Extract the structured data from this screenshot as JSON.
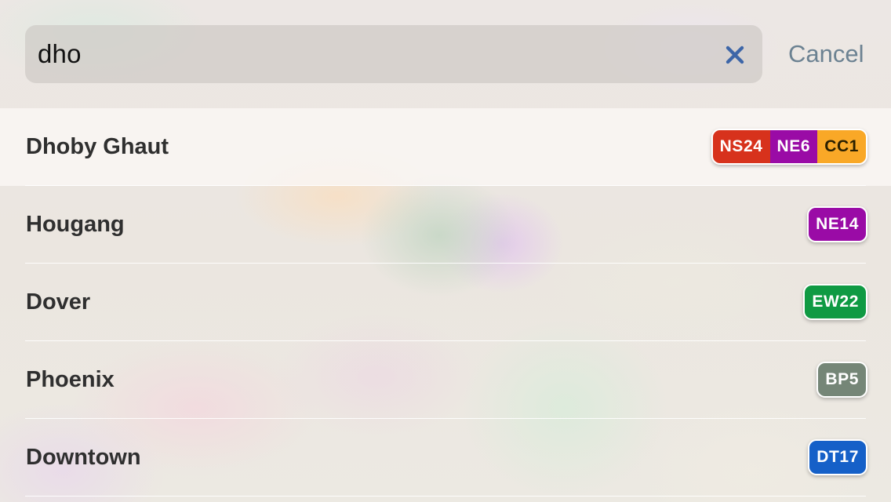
{
  "search": {
    "query": "dho",
    "cancel_label": "Cancel"
  },
  "results": [
    {
      "name": "Dhoby Ghaut",
      "selected": true,
      "codes": [
        {
          "label": "NS24",
          "color": "#d7321c"
        },
        {
          "label": "NE6",
          "color": "#9a0ba6"
        },
        {
          "label": "CC1",
          "color": "#f9a827"
        }
      ]
    },
    {
      "name": "Hougang",
      "codes": [
        {
          "label": "NE14",
          "color": "#9a0ba6"
        }
      ]
    },
    {
      "name": "Dover",
      "codes": [
        {
          "label": "EW22",
          "color": "#0f9a43"
        }
      ]
    },
    {
      "name": "Phoenix",
      "codes": [
        {
          "label": "BP5",
          "color": "#758677"
        }
      ]
    },
    {
      "name": "Downtown",
      "codes": [
        {
          "label": "DT17",
          "color": "#1560c8"
        }
      ]
    }
  ]
}
